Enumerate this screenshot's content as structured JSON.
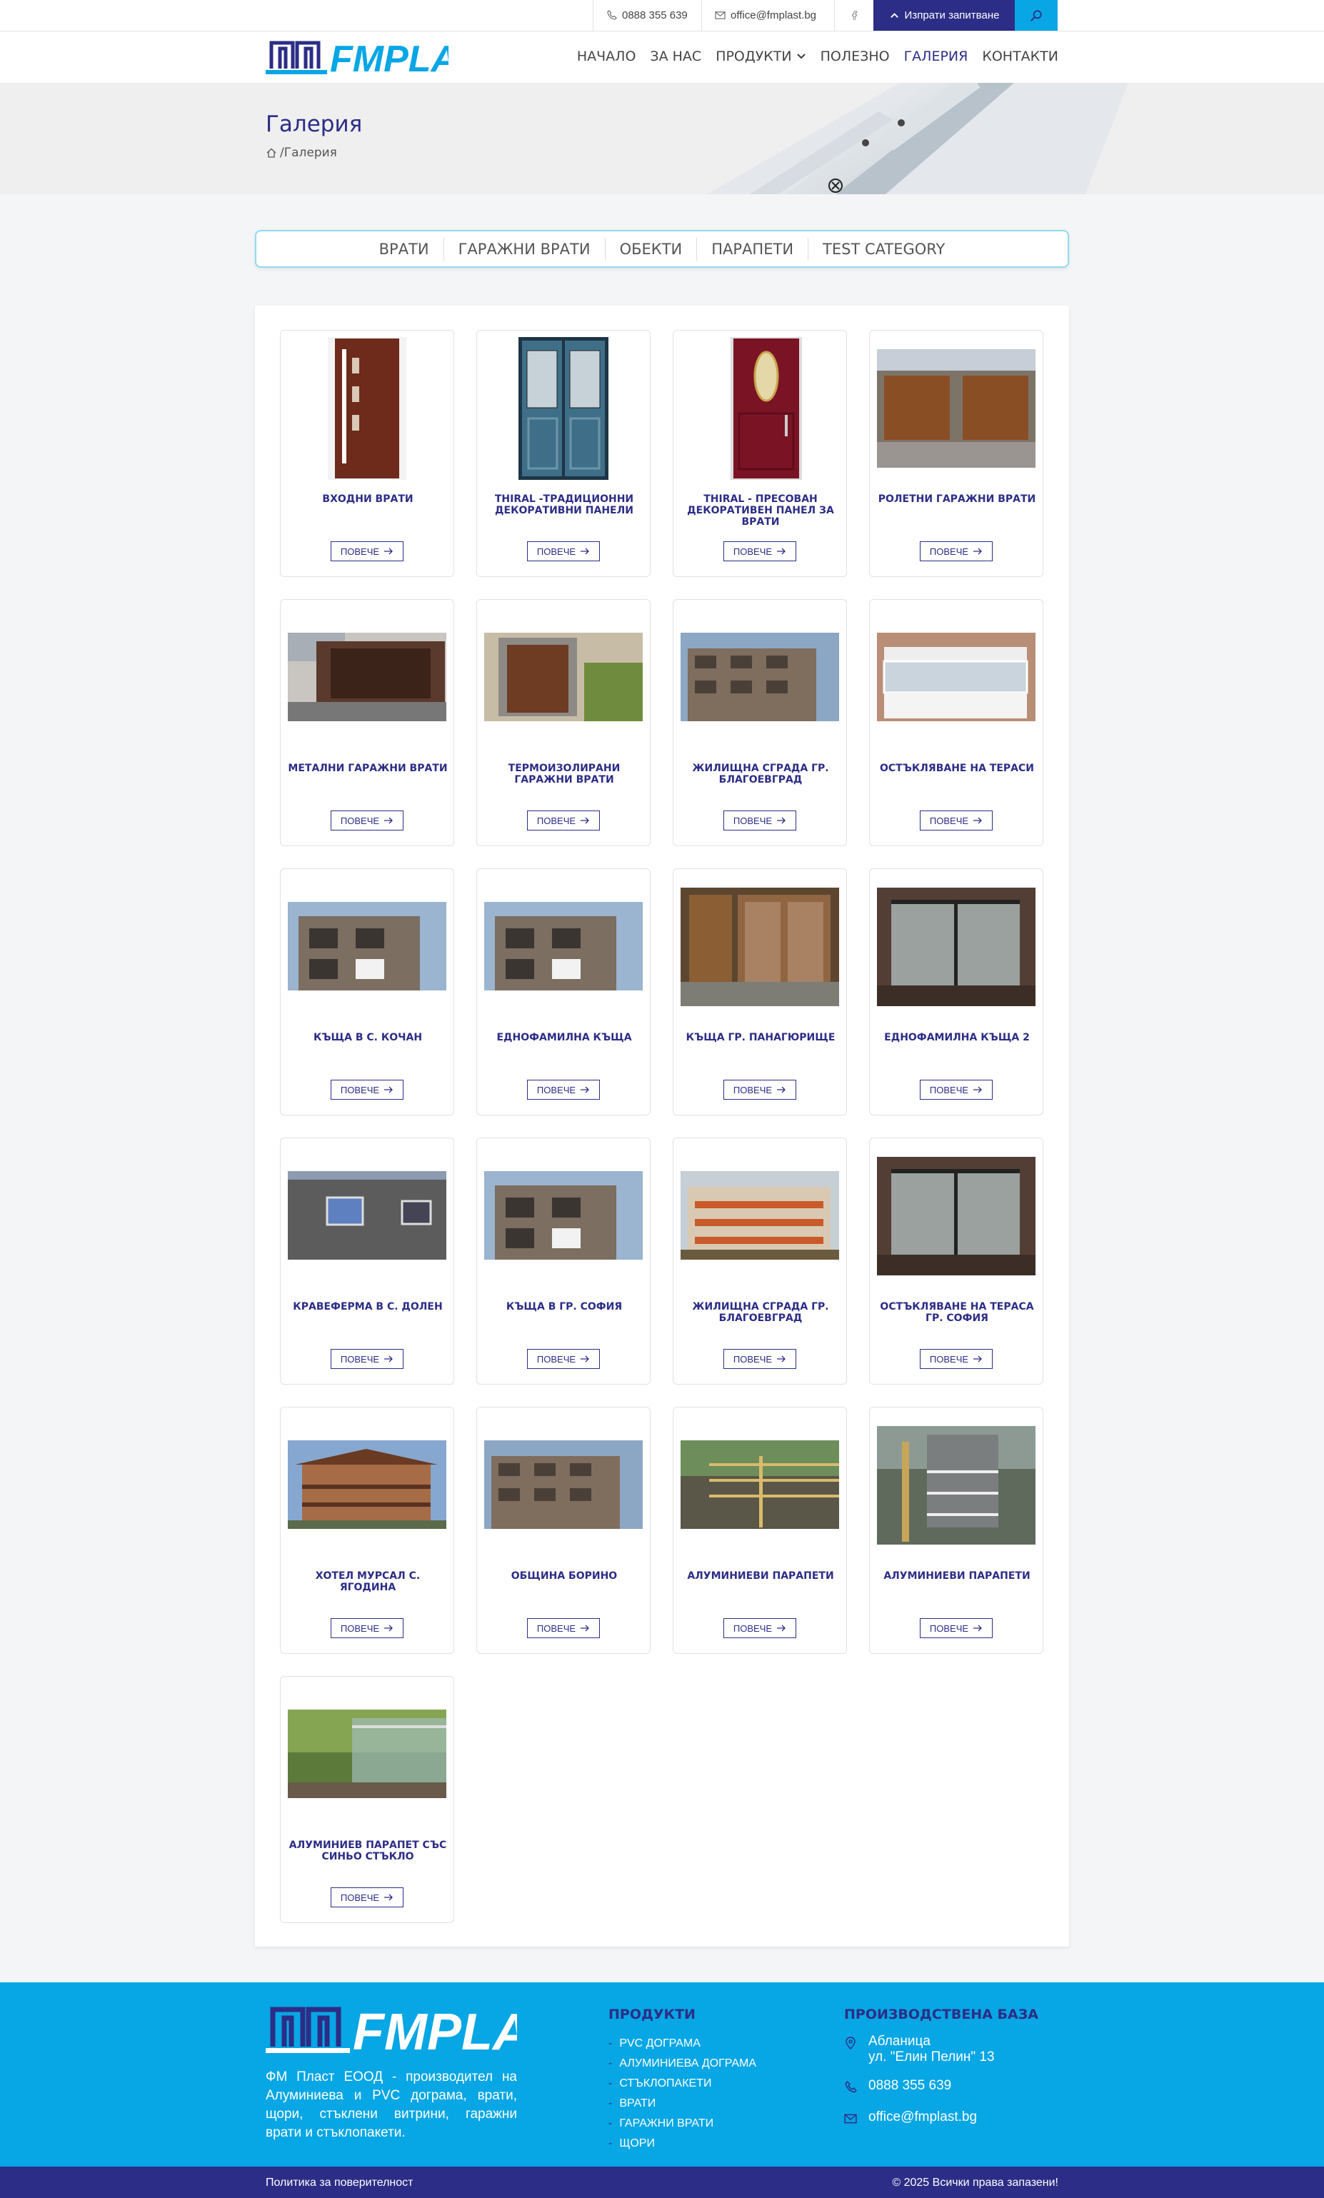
{
  "topbar": {
    "phone": "0888 355 639",
    "email": "office@fmplast.bg",
    "inquiry_button": "Изпрати запитване"
  },
  "brand": {
    "logo_text": "FMPLAST",
    "primary": "#2c2d86",
    "accent": "#09a6e5"
  },
  "nav": {
    "items": [
      "НАЧАЛО",
      "ЗА НАС",
      "ПРОДУКТИ",
      "ПОЛЕЗНО",
      "ГАЛЕРИЯ",
      "КОНТАКТИ"
    ],
    "active": "ГАЛЕРИЯ"
  },
  "hero": {
    "title": "Галерия",
    "breadcrumb": "/Галерия"
  },
  "tabs": [
    "ВРАТИ",
    "ГАРАЖНИ ВРАТИ",
    "ОБЕКТИ",
    "ПАРАПЕТИ",
    "TEST CATEGORY"
  ],
  "gallery": {
    "more_label": "ПОВЕЧЕ",
    "items": [
      {
        "title": "ВХОДНИ ВРАТИ",
        "image": "door-brown"
      },
      {
        "title": "THIRAL -ТРАДИЦИОННИ ДЕКОРАТИВНИ ПАНЕЛИ",
        "image": "door-blue"
      },
      {
        "title": "THIRAL - ПРЕСОВАН ДЕКОРАТИВЕН ПАНЕЛ ЗА ВРАТИ",
        "image": "door-red"
      },
      {
        "title": "РОЛЕТНИ ГАРАЖНИ ВРАТИ",
        "image": "garage"
      },
      {
        "title": "МЕТАЛНИ ГАРАЖНИ ВРАТИ",
        "image": "garage-dark"
      },
      {
        "title": "ТЕРМОИЗОЛИРАНИ ГАРАЖНИ ВРАТИ",
        "image": "garage-single"
      },
      {
        "title": "ЖИЛИЩНА СГРАДА ГР. БЛАГОЕВГРАД",
        "image": "building"
      },
      {
        "title": "ОСТЪКЛЯВАНЕ НА ТЕРАСИ",
        "image": "terrace"
      },
      {
        "title": "КЪЩА В С. КОЧАН",
        "image": "house"
      },
      {
        "title": "ЕДНОФАМИЛНА КЪЩА",
        "image": "house"
      },
      {
        "title": "КЪЩА ГР. ПАНАГЮРИЩЕ",
        "image": "wood-glass"
      },
      {
        "title": "ЕДНОФАМИЛНА КЪЩА 2",
        "image": "interior"
      },
      {
        "title": "КРАВЕФЕРМА В С. ДОЛЕН",
        "image": "stone"
      },
      {
        "title": "КЪЩА В ГР. СОФИЯ",
        "image": "house"
      },
      {
        "title": "ЖИЛИЩНА СГРАДА ГР. БЛАГОЕВГРАД",
        "image": "building-orange"
      },
      {
        "title": "ОСТЪКЛЯВАНЕ НА ТЕРАСА ГР. СОФИЯ",
        "image": "interior"
      },
      {
        "title": "ХОТЕЛ МУРСАЛ С. ЯГОДИНА",
        "image": "hotel"
      },
      {
        "title": "ОБЩИНА БОРИНО",
        "image": "building"
      },
      {
        "title": "АЛУМИНИЕВИ ПАРАПЕТИ",
        "image": "railing"
      },
      {
        "title": "АЛУМИНИЕВИ ПАРАПЕТИ",
        "image": "railing-tall"
      },
      {
        "title": "АЛУМИНИЕВ ПАРАПЕТ СЪС СИНЬО СТЪКЛО",
        "image": "railing-green"
      }
    ]
  },
  "footer": {
    "description": "ФМ Пласт ЕООД - производител на Алуминиева и PVC дограма, врати, щори, стъклени витрини, гаражни врати и стъклопакети.",
    "products_heading": "ПРОДУКТИ",
    "products": [
      "PVC ДОГРАМА",
      "АЛУМИНИЕВА ДОГРАМА",
      "СТЪКЛОПАКЕТИ",
      "ВРАТИ",
      "ГАРАЖНИ ВРАТИ",
      "ЩОРИ"
    ],
    "base_heading": "ПРОИЗВОДСТВЕНА БАЗА",
    "address_line1": "Абланица",
    "address_line2": "ул. \"Елин Пелин\" 13",
    "phone": "0888 355 639",
    "email": "office@fmplast.bg",
    "privacy": "Политика за поверителност",
    "copyright": "© 2025 Всички права запазени!"
  }
}
